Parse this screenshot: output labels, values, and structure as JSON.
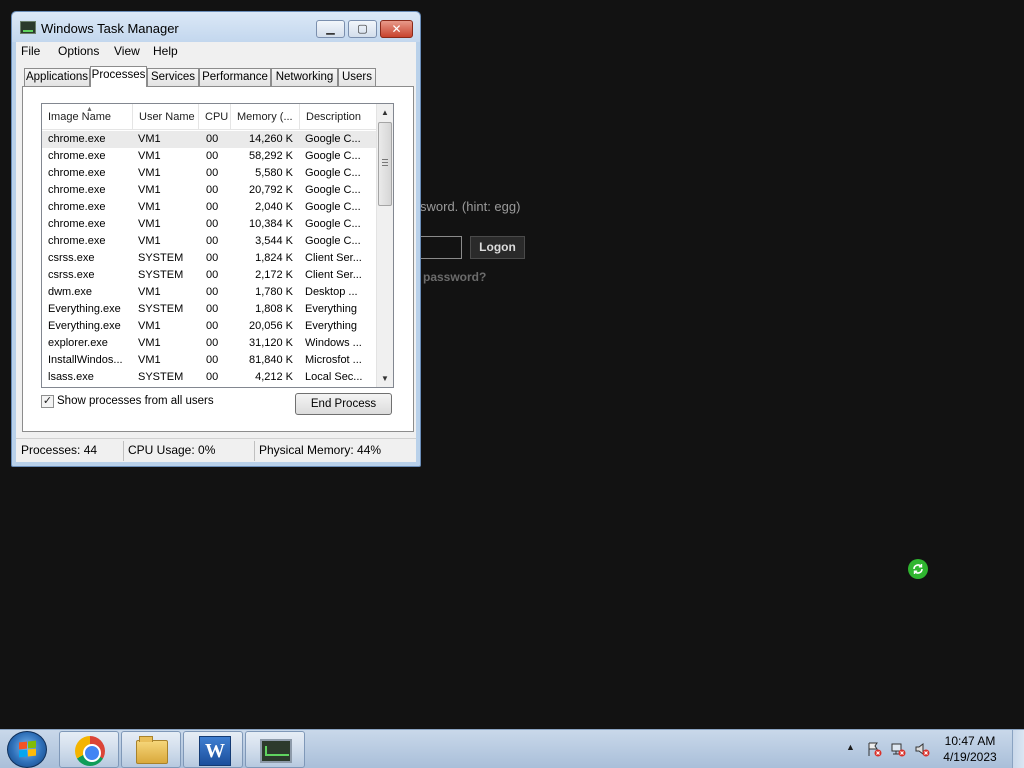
{
  "background": {
    "hint_text": "sword. (hint: egg)",
    "logon_button": "Logon",
    "forgot_text": "password?"
  },
  "window": {
    "title": "Windows Task Manager",
    "minimize_glyph": "▁",
    "maximize_glyph": "▢",
    "close_glyph": "✕"
  },
  "menu": {
    "file": "File",
    "options": "Options",
    "view": "View",
    "help": "Help"
  },
  "tabs": [
    {
      "label": "Applications"
    },
    {
      "label": "Processes",
      "active": true
    },
    {
      "label": "Services"
    },
    {
      "label": "Performance"
    },
    {
      "label": "Networking"
    },
    {
      "label": "Users"
    }
  ],
  "columns": {
    "image_name": "Image Name",
    "user_name": "User Name",
    "cpu": "CPU",
    "memory": "Memory (...",
    "description": "Description"
  },
  "processes": [
    {
      "name": "chrome.exe",
      "user": "VM1",
      "cpu": "00",
      "mem": "14,260 K",
      "desc": "Google C..."
    },
    {
      "name": "chrome.exe",
      "user": "VM1",
      "cpu": "00",
      "mem": "58,292 K",
      "desc": "Google C..."
    },
    {
      "name": "chrome.exe",
      "user": "VM1",
      "cpu": "00",
      "mem": "5,580 K",
      "desc": "Google C..."
    },
    {
      "name": "chrome.exe",
      "user": "VM1",
      "cpu": "00",
      "mem": "20,792 K",
      "desc": "Google C..."
    },
    {
      "name": "chrome.exe",
      "user": "VM1",
      "cpu": "00",
      "mem": "2,040 K",
      "desc": "Google C..."
    },
    {
      "name": "chrome.exe",
      "user": "VM1",
      "cpu": "00",
      "mem": "10,384 K",
      "desc": "Google C..."
    },
    {
      "name": "chrome.exe",
      "user": "VM1",
      "cpu": "00",
      "mem": "3,544 K",
      "desc": "Google C..."
    },
    {
      "name": "csrss.exe",
      "user": "SYSTEM",
      "cpu": "00",
      "mem": "1,824 K",
      "desc": "Client Ser..."
    },
    {
      "name": "csrss.exe",
      "user": "SYSTEM",
      "cpu": "00",
      "mem": "2,172 K",
      "desc": "Client Ser..."
    },
    {
      "name": "dwm.exe",
      "user": "VM1",
      "cpu": "00",
      "mem": "1,780 K",
      "desc": "Desktop ..."
    },
    {
      "name": "Everything.exe",
      "user": "SYSTEM",
      "cpu": "00",
      "mem": "1,808 K",
      "desc": "Everything"
    },
    {
      "name": "Everything.exe",
      "user": "VM1",
      "cpu": "00",
      "mem": "20,056 K",
      "desc": "Everything"
    },
    {
      "name": "explorer.exe",
      "user": "VM1",
      "cpu": "00",
      "mem": "31,120 K",
      "desc": "Windows ..."
    },
    {
      "name": "InstallWindos...",
      "user": "VM1",
      "cpu": "00",
      "mem": "81,840 K",
      "desc": "Microsfot ..."
    },
    {
      "name": "lsass.exe",
      "user": "SYSTEM",
      "cpu": "00",
      "mem": "4,212 K",
      "desc": "Local Sec..."
    }
  ],
  "controls": {
    "show_all_label": "Show processes from all users",
    "show_all_checked": true,
    "checkmark": "✓",
    "end_process": "End Process"
  },
  "status": {
    "processes": "Processes: 44",
    "cpu_usage": "CPU Usage: 0%",
    "physical_memory": "Physical Memory: 44%"
  },
  "taskbar": {
    "word_letter": "W",
    "tray_arrow": "▲",
    "time": "10:47 AM",
    "date": "4/19/2023"
  }
}
